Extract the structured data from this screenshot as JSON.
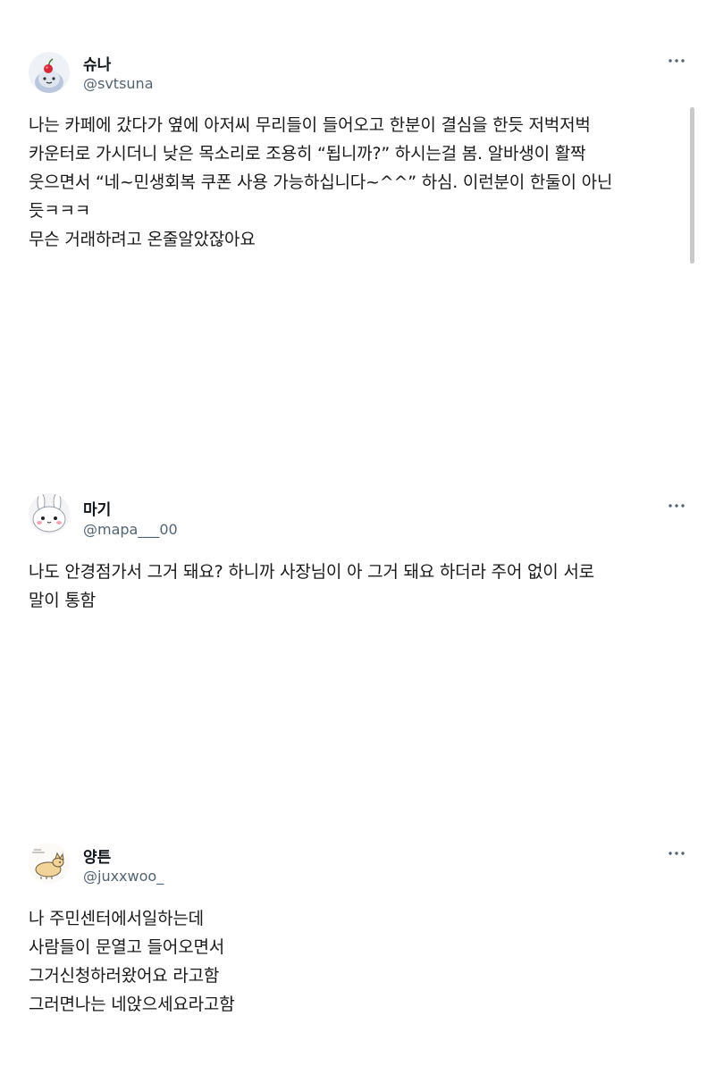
{
  "tweets": [
    {
      "name": "슈나",
      "handle": "@svtsuna",
      "avatar_icon": "cherry-character-avatar-icon",
      "lines": [
        "나는 카페에 갔다가 옆에 아저씨 무리들이 들어오고 한분이 결심을 한듯 저벅저벅",
        "카운터로 가시더니 낮은 목소리로 조용히 “됩니까?” 하시는걸 봄. 알바생이 활짝",
        "웃으면서 “네~민생회복 쿠폰 사용 가능하십니다~^^” 하심. 이런분이 한둘이 아닌",
        "듯ㅋㅋㅋ",
        "무슨 거래하려고 온줄알았잖아요"
      ]
    },
    {
      "name": "마기",
      "handle": "@mapa___00",
      "avatar_icon": "white-bunny-avatar-icon",
      "lines": [
        "나도 안경점가서 그거 돼요? 하니까 사장님이 아 그거 돼요 하더라 주어 없이 서로",
        "말이 통함"
      ]
    },
    {
      "name": "양튼",
      "handle": "@juxxwoo_",
      "avatar_icon": "corgi-sketch-avatar-icon",
      "lines": [
        "나 주민센터에서일하는데",
        "사람들이 문열고 들어오면서",
        "그거신청하러왔어요 라고함",
        "그러면나는 네앉으세요라고함"
      ]
    }
  ],
  "more_icon": "more-horizontal-icon",
  "colors": {
    "text": "#0f1419",
    "handle": "#536471",
    "scrollbar": "#c9c9c9"
  }
}
